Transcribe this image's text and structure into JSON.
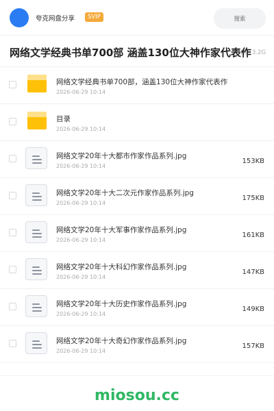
{
  "header": {
    "share_name": "夸克网盘分享",
    "badge": "SVIP",
    "search_placeholder": "搜索"
  },
  "title": {
    "text": "网络文学经典书单700部 涵盖130位大神作家代表作",
    "meta_partial": "期 · 3.2G"
  },
  "files": [
    {
      "name": "网络文学经典书单700部，涵盖130位大神作家代表作",
      "date": "2026-06-29 10:14",
      "size": "",
      "type": "folder"
    },
    {
      "name": "目录",
      "date": "2026-06-29 10:14",
      "size": "",
      "type": "folder"
    },
    {
      "name": "网络文学20年十大都市作家作品系列.jpg",
      "date": "2026-06-29 10:14",
      "size": "153KB",
      "type": "file"
    },
    {
      "name": "网络文学20年十大二次元作家作品系列.jpg",
      "date": "2026-06-29 10:14",
      "size": "175KB",
      "type": "file"
    },
    {
      "name": "网络文学20年十大军事作家作品系列.jpg",
      "date": "2026-06-29 10:14",
      "size": "161KB",
      "type": "file"
    },
    {
      "name": "网络文学20年十大科幻作家作品系列.jpg",
      "date": "2026-06-29 10:14",
      "size": "147KB",
      "type": "file"
    },
    {
      "name": "网络文学20年十大历史作家作品系列.jpg",
      "date": "2026-06-29 10:14",
      "size": "149KB",
      "type": "file"
    },
    {
      "name": "网络文学20年十大奇幻作家作品系列.jpg",
      "date": "2026-06-29 10:14",
      "size": "157KB",
      "type": "file"
    }
  ],
  "footer": {
    "brand": "miosou.cc"
  },
  "colors": {
    "avatar": "#2b7cf3",
    "svip_badge": "#f5a93a",
    "folder": "#ffc107",
    "brand": "#2fb864"
  }
}
